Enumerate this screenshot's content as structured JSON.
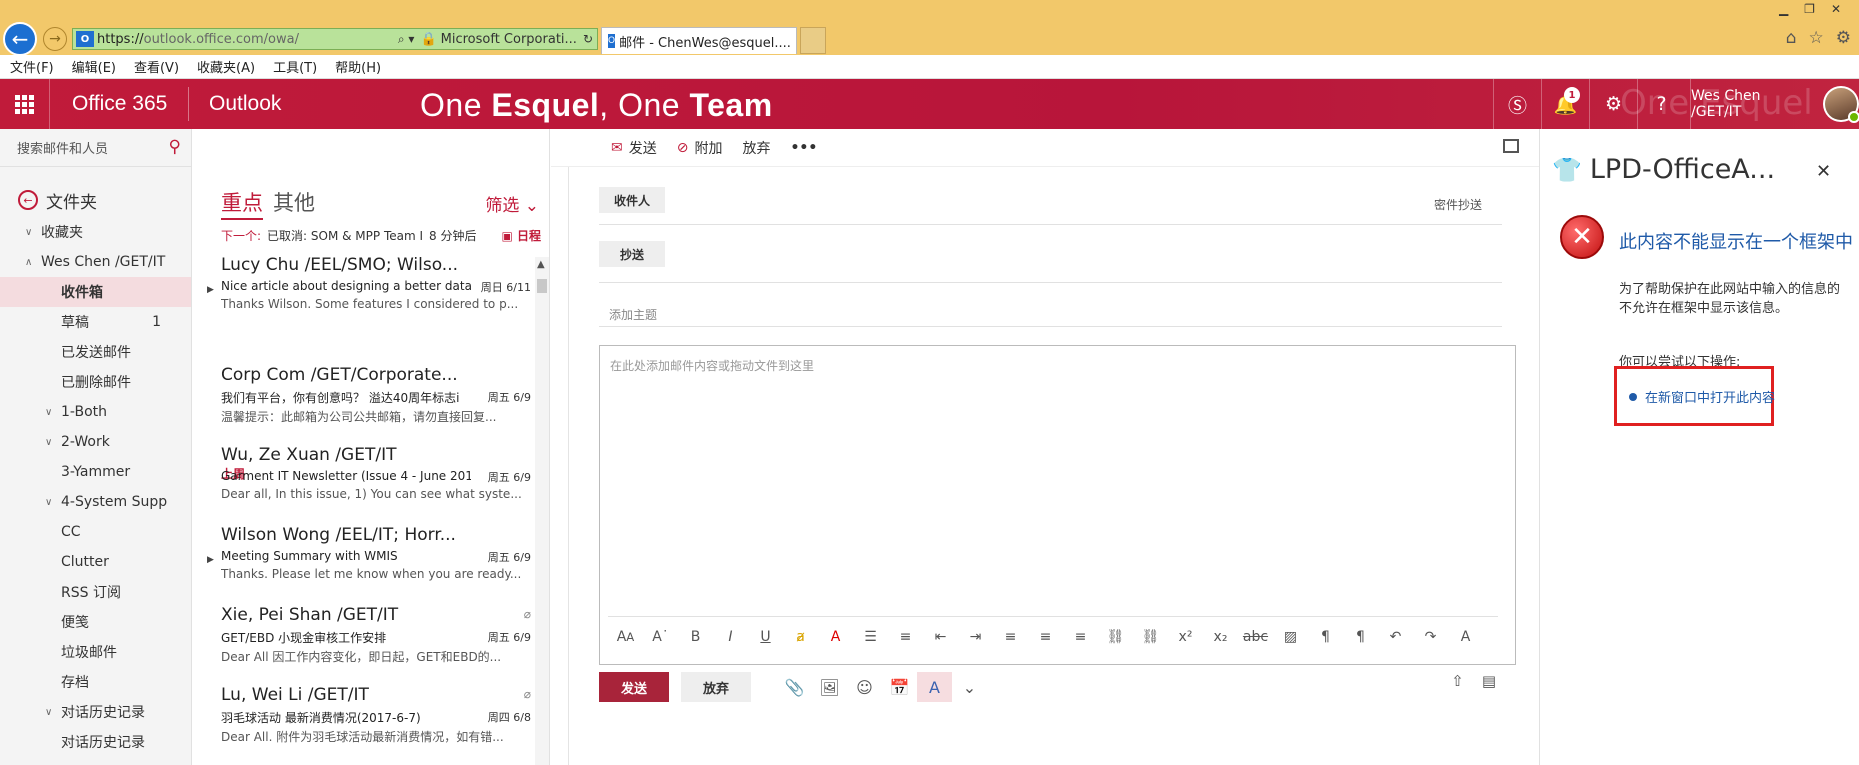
{
  "browser": {
    "url_prefix": "https://",
    "url_host": "outlook.office.com",
    "url_path": "/owa/",
    "cert_label": "Microsoft Corporati...",
    "tab_title": "邮件 - ChenWes@esquel....",
    "menu": [
      "文件(F)",
      "编辑(E)",
      "查看(V)",
      "收藏夹(A)",
      "工具(T)",
      "帮助(H)"
    ]
  },
  "header": {
    "suite": "Office 365",
    "app": "Outlook",
    "banner_pre1": "One ",
    "banner_b1": "Esquel",
    "banner_pre2": ", One ",
    "banner_b2": "Team",
    "notif_count": "1",
    "user_name": "Wes Chen /GET/IT",
    "accent": "#c01b3a"
  },
  "sidebar": {
    "search_placeholder": "搜索邮件和人员",
    "folders_title": "文件夹",
    "items": [
      {
        "label": "收藏夹",
        "chev": "∨",
        "indent": 1
      },
      {
        "label": "Wes Chen /GET/IT",
        "chev": "∧",
        "indent": 1
      },
      {
        "label": "收件箱",
        "indent": 2,
        "selected": true
      },
      {
        "label": "草稿",
        "indent": 2,
        "count": "1"
      },
      {
        "label": "已发送邮件",
        "indent": 2
      },
      {
        "label": "已删除邮件",
        "indent": 2
      },
      {
        "label": "1-Both",
        "chev": "∨",
        "indent": 2
      },
      {
        "label": "2-Work",
        "chev": "∨",
        "indent": 2
      },
      {
        "label": "3-Yammer",
        "indent": 2
      },
      {
        "label": "4-System Supp",
        "chev": "∨",
        "indent": 2
      },
      {
        "label": "CC",
        "indent": 2
      },
      {
        "label": "Clutter",
        "indent": 2
      },
      {
        "label": "RSS 订阅",
        "indent": 2
      },
      {
        "label": "便笺",
        "indent": 2
      },
      {
        "label": "垃圾邮件",
        "indent": 2
      },
      {
        "label": "存档",
        "indent": 2
      },
      {
        "label": "对话历史记录",
        "chev": "∨",
        "indent": 2
      },
      {
        "label": "对话历史记录",
        "indent": 2
      }
    ]
  },
  "maillist": {
    "tab_focused": "重点",
    "tab_other": "其他",
    "filter": "筛选",
    "next_label": "下一个:",
    "next_text": "已取消: SOM & MPP Team I",
    "next_time": "8 分钟后",
    "next_cal": "日程",
    "section_last_week": "上周",
    "messages": [
      {
        "from": "Lucy Chu /EEL/SMO; Wilso...",
        "subject": "Nice article about designing a better data",
        "date": "周日 6/11",
        "preview": "Thanks Wilson. Some features I considered to p...",
        "arrow": true,
        "clip": false
      },
      {
        "from": "Corp Com /GET/Corporate...",
        "subject": "我们有平台，你有创意吗？ 溢达40周年标志i",
        "date": "周五 6/9",
        "preview": "温馨提示：此邮箱为公司公共邮箱，请勿直接回复...",
        "arrow": false,
        "clip": false
      },
      {
        "from": "Wu, Ze Xuan /GET/IT",
        "subject": "Garment IT Newsletter (Issue 4 - June 201",
        "date": "周五 6/9",
        "preview": "Dear all, In this issue, 1) You can see what syste...",
        "arrow": false,
        "clip": false
      },
      {
        "from": "Wilson Wong /EEL/IT; Horr...",
        "subject": "Meeting Summary with WMIS",
        "date": "周五 6/9",
        "preview": "Thanks. Please let me know when you are ready...",
        "arrow": true,
        "clip": false
      },
      {
        "from": "Xie, Pei Shan /GET/IT",
        "subject": "GET/EBD 小现金审核工作安排",
        "date": "周五 6/9",
        "preview": "Dear All 因工作内容变化，即日起，GET和EBD的...",
        "arrow": false,
        "clip": true
      },
      {
        "from": "Lu, Wei Li /GET/IT",
        "subject": "羽毛球活动 最新消费情况(2017-6-7)",
        "date": "周四 6/8",
        "preview": "Dear All. 附件为羽毛球活动最新消费情况，如有错...",
        "arrow": false,
        "clip": true
      }
    ]
  },
  "compose": {
    "toolbar_send": "发送",
    "toolbar_attach": "附加",
    "toolbar_discard": "放弃",
    "toolbar_more": "•••",
    "to_label": "收件人",
    "bcc_label": "密件抄送",
    "cc_label": "抄送",
    "subject_placeholder": "添加主题",
    "body_placeholder": "在此处添加邮件内容或拖动文件到这里",
    "send_btn": "发送",
    "discard_btn": "放弃",
    "send_color": "#a8243a"
  },
  "addin": {
    "title": "LPD-OfficeA...",
    "error_title": "此内容不能显示在一个框架中",
    "error_line1": "为了帮助保护在此网站中输入的信息的",
    "error_line2": "不允许在框架中显示该信息。",
    "try_text": "你可以尝试以下操作:",
    "open_link": "在新窗口中打开此内容"
  }
}
